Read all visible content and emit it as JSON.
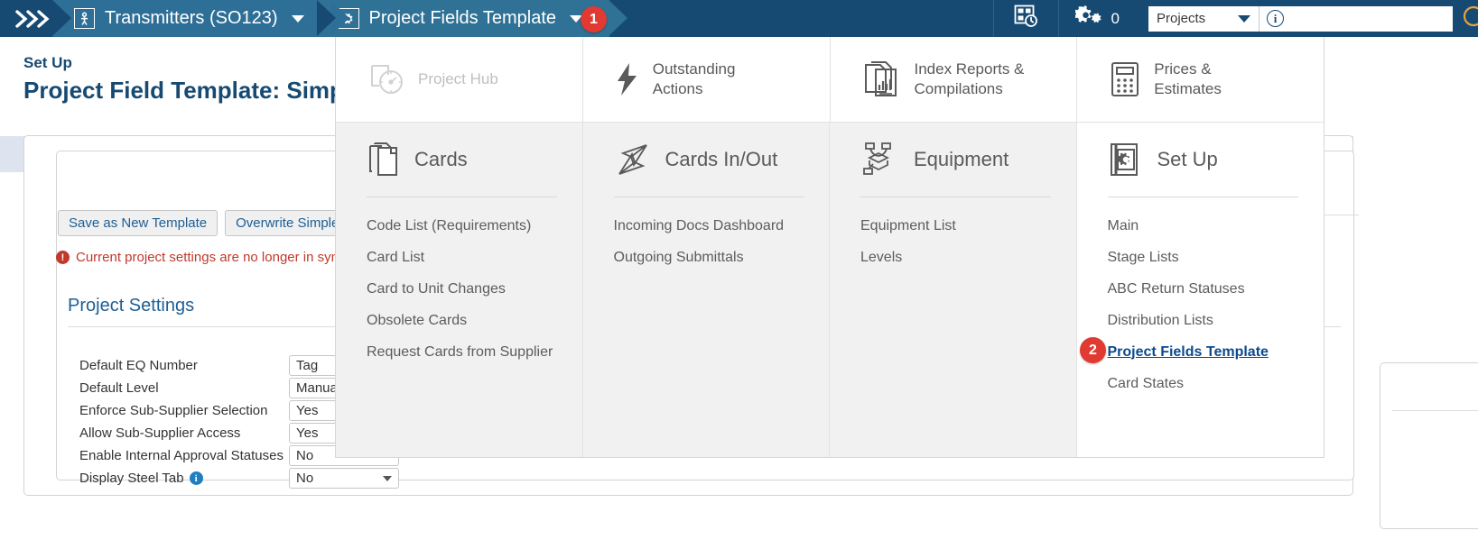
{
  "topbar": {
    "menu_toggle_icon": "chevrons-right-icon",
    "breadcrumbs": [
      {
        "label": "Transmitters (SO123)",
        "icon": "person-document-icon",
        "has_caret": true
      },
      {
        "label": "Project Fields Template",
        "icon": "gear-box-icon",
        "has_caret": true
      }
    ],
    "recent_icon": "recent-items-icon",
    "gear_icon": "gears-icon",
    "gear_count": "0",
    "project_select": {
      "value": "Projects",
      "icon": "chevron-down-icon"
    },
    "info_icon": "info-circle-icon",
    "info_value": ""
  },
  "page": {
    "eyebrow": "Set Up",
    "title": "Project Field Template: Simple",
    "buttons": [
      {
        "label": "Save as New Template"
      },
      {
        "label": "Overwrite Simple (system)"
      }
    ],
    "warning": {
      "icon": "error-icon",
      "text": "Current project settings are no longer in sync with the template"
    },
    "panel_title": "Project Settings",
    "settings": [
      {
        "label": "Default EQ Number",
        "value": "Tag",
        "type": "text"
      },
      {
        "label": "Default Level",
        "value": "Manual",
        "type": "text"
      },
      {
        "label": "Enforce Sub-Supplier Selection",
        "value": "Yes",
        "type": "text"
      },
      {
        "label": "Allow Sub-Supplier Access",
        "value": "Yes",
        "type": "text"
      },
      {
        "label": "Enable Internal Approval Statuses",
        "value": "No",
        "type": "text"
      },
      {
        "label": "Display Steel Tab",
        "value": "No",
        "type": "select",
        "info_icon": "info-circle-icon"
      }
    ]
  },
  "megamenu": {
    "top_items": [
      {
        "label": "Project Hub",
        "icon": "dashboard-gauge-icon",
        "disabled": true
      },
      {
        "label": "Outstanding Actions",
        "icon": "lightning-bolt-icon",
        "disabled": false
      },
      {
        "label": "Index Reports & Compilations",
        "icon": "stacked-reports-icon",
        "disabled": false
      },
      {
        "label": "Prices & Estimates",
        "icon": "calculator-icon",
        "disabled": false
      }
    ],
    "columns": [
      {
        "title": "Cards",
        "icon": "copy-pages-icon",
        "items": [
          "Code List (Requirements)",
          "Card List",
          "Card to Unit Changes",
          "Obsolete Cards",
          "Request Cards from Supplier"
        ]
      },
      {
        "title": "Cards In/Out",
        "icon": "paper-planes-icon",
        "items": [
          "Incoming Docs Dashboard",
          "Outgoing Submittals"
        ]
      },
      {
        "title": "Equipment",
        "icon": "equipment-network-icon",
        "items": [
          "Equipment List",
          "Levels"
        ]
      },
      {
        "title": "Set Up",
        "icon": "gear-book-icon",
        "items": [
          "Main",
          "Stage Lists",
          "ABC Return Statuses",
          "Distribution Lists",
          "Project Fields Template",
          "Card States"
        ],
        "active_item": "Project Fields Template"
      }
    ]
  },
  "annotations": [
    {
      "number": "1",
      "target": "breadcrumb-project-fields-template"
    },
    {
      "number": "2",
      "target": "menu-item-project-fields-template"
    }
  ],
  "colors": {
    "topbar": "#164a72",
    "crumb": "#2e6f97",
    "accent_link": "#0b4a8f",
    "badge": "#e03a32",
    "warning": "#c0392b",
    "band": "#dde3ef"
  }
}
